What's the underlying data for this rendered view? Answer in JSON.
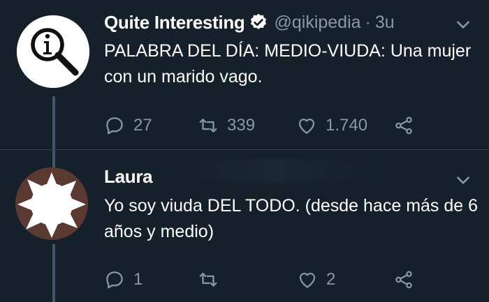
{
  "tweets": [
    {
      "name": "Quite Interesting",
      "verified": true,
      "handle": "@qikipedia",
      "separator": "·",
      "time": "3u",
      "text": "PALABRA DEL DÍA: MEDIO-VIUDA: Una mujer con un marido vago.",
      "avatar_icon": "magnifier-info-icon",
      "actions": {
        "replies": "27",
        "retweets": "339",
        "likes": "1.740"
      }
    },
    {
      "name": "Laura",
      "verified": false,
      "text": "Yo soy viuda DEL TODO. (desde hace más de 6 años y medio)",
      "avatar_icon": "redacted-avatar",
      "actions": {
        "replies": "1",
        "retweets": "",
        "likes": "2"
      }
    }
  ],
  "colors": {
    "background": "#15202b",
    "muted": "#8899a6",
    "thread_line": "#42536a",
    "verified": "#1da1f2"
  }
}
